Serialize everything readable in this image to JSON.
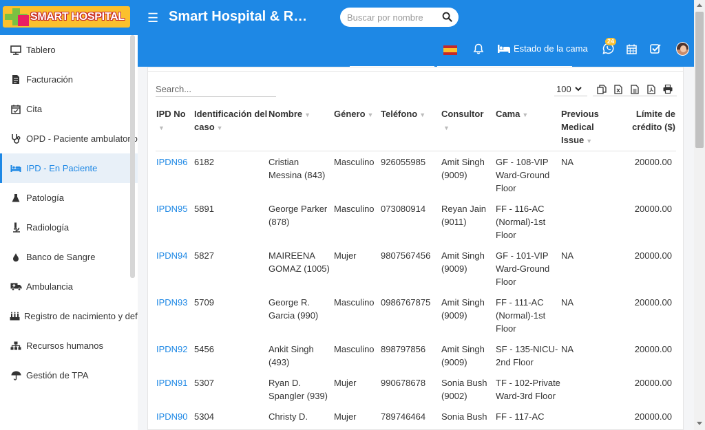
{
  "brand": {
    "logo_text": "SMART HOSPITAL",
    "title": "Smart Hospital & R…"
  },
  "header": {
    "search_placeholder": "Buscar por nombre",
    "bed_status_label": "Estado de la cama",
    "whatsapp_badge": "24",
    "colors": {
      "primary": "#1e88e5",
      "accent": "#fbc02d"
    }
  },
  "sidebar": {
    "items": [
      {
        "label": "Tablero",
        "icon": "monitor-icon"
      },
      {
        "label": "Facturación",
        "icon": "invoice-icon"
      },
      {
        "label": "Cita",
        "icon": "calendar-check-icon"
      },
      {
        "label": "OPD - Paciente ambulatorio",
        "icon": "stethoscope-icon"
      },
      {
        "label": "IPD - En Paciente",
        "icon": "bed-icon",
        "active": true
      },
      {
        "label": "Patología",
        "icon": "flask-icon"
      },
      {
        "label": "Radiología",
        "icon": "microscope-icon"
      },
      {
        "label": "Banco de Sangre",
        "icon": "blood-drop-icon"
      },
      {
        "label": "Ambulancia",
        "icon": "ambulance-icon"
      },
      {
        "label": "Registro de nacimiento y defunción",
        "icon": "birth-death-icon"
      },
      {
        "label": "Recursos humanos",
        "icon": "sitemap-icon"
      },
      {
        "label": "Gestión de TPA",
        "icon": "umbrella-icon"
      }
    ]
  },
  "table": {
    "search_placeholder": "Search...",
    "page_size": "100",
    "columns": [
      "IPD No",
      "Identificación del caso",
      "Nombre",
      "Género",
      "Teléfono",
      "Consultor",
      "Cama",
      "Previous Medical Issue",
      "Límite de crédito ($)"
    ],
    "rows": [
      {
        "ipd": "IPDN96",
        "case_id": "6182",
        "name": "Cristian Messina (843)",
        "gender": "Masculino",
        "phone": "926055985",
        "consultant": "Amit Singh (9009)",
        "bed": "GF - 108-VIP Ward-Ground Floor",
        "issue": "NA",
        "credit": "20000.00"
      },
      {
        "ipd": "IPDN95",
        "case_id": "5891",
        "name": "George Parker (878)",
        "gender": "Masculino",
        "phone": "073080914",
        "consultant": "Reyan Jain (9011)",
        "bed": "FF - 116-AC (Normal)-1st Floor",
        "issue": "",
        "credit": "20000.00"
      },
      {
        "ipd": "IPDN94",
        "case_id": "5827",
        "name": "MAIREENA GOMAZ (1005)",
        "gender": "Mujer",
        "phone": "9807567456",
        "consultant": "Amit Singh (9009)",
        "bed": "GF - 101-VIP Ward-Ground Floor",
        "issue": "NA",
        "credit": "20000.00"
      },
      {
        "ipd": "IPDN93",
        "case_id": "5709",
        "name": "George R. Garcia (990)",
        "gender": "Masculino",
        "phone": "0986767875",
        "consultant": "Amit Singh (9009)",
        "bed": "FF - 111-AC (Normal)-1st Floor",
        "issue": "NA",
        "credit": "20000.00"
      },
      {
        "ipd": "IPDN92",
        "case_id": "5456",
        "name": "Ankit Singh (493)",
        "gender": "Masculino",
        "phone": "898797856",
        "consultant": "Amit Singh (9009)",
        "bed": "SF - 135-NICU-2nd Floor",
        "issue": "NA",
        "credit": "20000.00"
      },
      {
        "ipd": "IPDN91",
        "case_id": "5307",
        "name": "Ryan D. Spangler (939)",
        "gender": "Mujer",
        "phone": "990678678",
        "consultant": "Sonia Bush (9002)",
        "bed": "TF - 102-Private Ward-3rd Floor",
        "issue": "",
        "credit": "20000.00"
      },
      {
        "ipd": "IPDN90",
        "case_id": "5304",
        "name": "Christy D.",
        "gender": "Mujer",
        "phone": "789746464",
        "consultant": "Sonia Bush",
        "bed": "FF - 117-AC",
        "issue": "",
        "credit": "20000.00"
      }
    ]
  }
}
